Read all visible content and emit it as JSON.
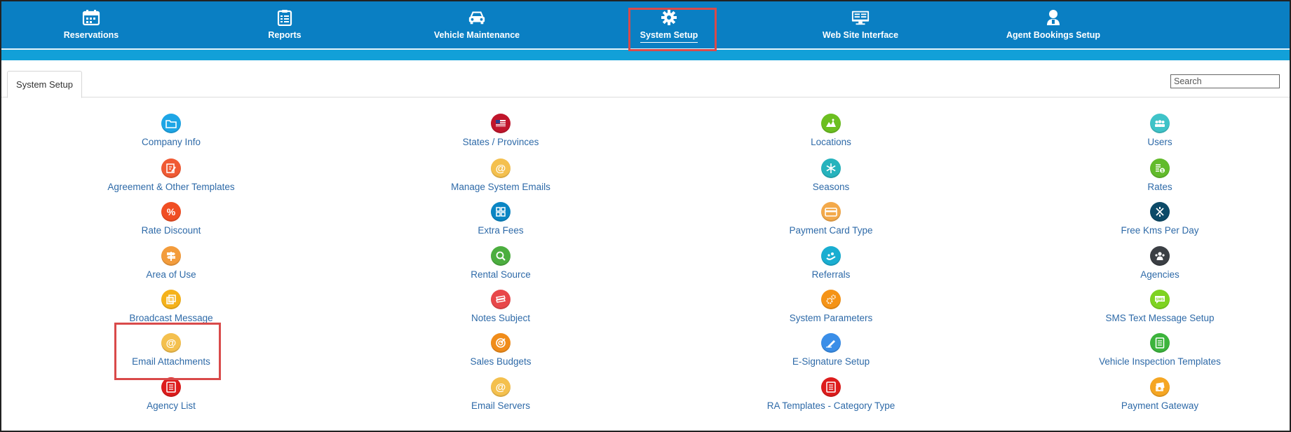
{
  "nav": {
    "items": [
      {
        "label": "Reservations",
        "icon": "calendar-icon"
      },
      {
        "label": "Reports",
        "icon": "clipboard-icon"
      },
      {
        "label": "Vehicle Maintenance",
        "icon": "car-icon"
      },
      {
        "label": "System Setup",
        "icon": "gear-icon",
        "active": true
      },
      {
        "label": "Web Site Interface",
        "icon": "monitor-icon"
      },
      {
        "label": "Agent Bookings Setup",
        "icon": "person-icon"
      }
    ]
  },
  "tabs": [
    {
      "label": "System Setup"
    }
  ],
  "search": {
    "placeholder": "Search",
    "value": ""
  },
  "columns": [
    [
      {
        "label": "Company Info",
        "icon": "folder-icon",
        "color": "#1ea6e6"
      },
      {
        "label": "Agreement & Other Templates",
        "icon": "document-edit-icon",
        "color": "#f05a34"
      },
      {
        "label": "Rate Discount",
        "icon": "percent-icon",
        "color": "#f04e23"
      },
      {
        "label": "Area of Use",
        "icon": "signpost-icon",
        "color": "#f39c3c"
      },
      {
        "label": "Broadcast Message",
        "icon": "stacked-squares-icon",
        "color": "#f5b21b"
      },
      {
        "label": "Email Attachments",
        "icon": "at-sign-icon",
        "color": "#f4c04e"
      },
      {
        "label": "Agency List",
        "icon": "list-icon",
        "color": "#dd1c1c"
      }
    ],
    [
      {
        "label": "States / Provinces",
        "icon": "flag-icon",
        "color": "#c0152b"
      },
      {
        "label": "Manage System Emails",
        "icon": "at-sign-icon",
        "color": "#f4c04e"
      },
      {
        "label": "Extra Fees",
        "icon": "grid-icon",
        "color": "#0b86c4"
      },
      {
        "label": "Rental Source",
        "icon": "magnifier-icon",
        "color": "#4cae3f"
      },
      {
        "label": "Notes Subject",
        "icon": "notes-icon",
        "color": "#e8474a"
      },
      {
        "label": "Sales Budgets",
        "icon": "target-icon",
        "color": "#f08c1a"
      },
      {
        "label": "Email Servers",
        "icon": "at-sign-icon",
        "color": "#f4c04e"
      }
    ],
    [
      {
        "label": "Locations",
        "icon": "map-icon",
        "color": "#6cbf20"
      },
      {
        "label": "Seasons",
        "icon": "snowflake-icon",
        "color": "#26b3bd"
      },
      {
        "label": "Payment Card Type",
        "icon": "credit-card-icon",
        "color": "#f3a94a"
      },
      {
        "label": "Referrals",
        "icon": "handshake-icon",
        "color": "#1aaed1"
      },
      {
        "label": "System Parameters",
        "icon": "gears-icon",
        "color": "#f59316"
      },
      {
        "label": "E-Signature Setup",
        "icon": "pen-icon",
        "color": "#3a8ee8"
      },
      {
        "label": "RA Templates - Category Type",
        "icon": "list-icon",
        "color": "#dd1c1c"
      }
    ],
    [
      {
        "label": "Users",
        "icon": "users-icon",
        "color": "#3fc3c8"
      },
      {
        "label": "Rates",
        "icon": "coin-list-icon",
        "color": "#62bb2b"
      },
      {
        "label": "Free Kms Per Day",
        "icon": "road-icon",
        "color": "#0c4a68"
      },
      {
        "label": "Agencies",
        "icon": "group-icon",
        "color": "#3b3f44"
      },
      {
        "label": "SMS Text Message Setup",
        "icon": "sms-bubble-icon",
        "color": "#7ed321"
      },
      {
        "label": "Vehicle Inspection Templates",
        "icon": "checklist-icon",
        "color": "#3cb43c"
      },
      {
        "label": "Payment Gateway",
        "icon": "money-icon",
        "color": "#f5a623"
      }
    ]
  ]
}
